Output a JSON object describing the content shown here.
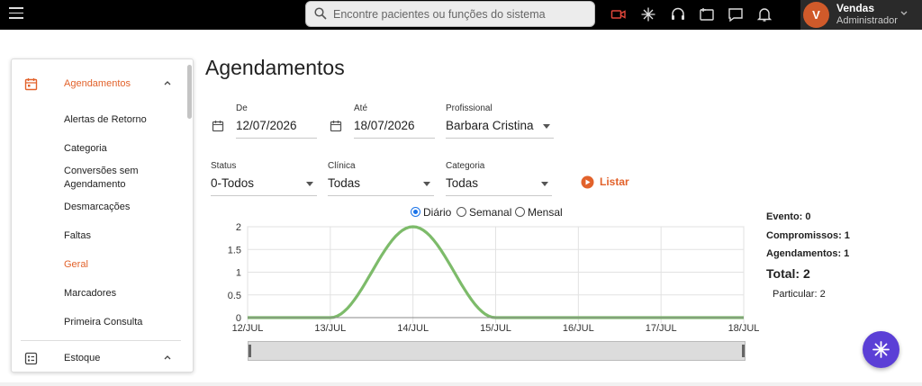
{
  "search": {
    "placeholder": "Encontre pacientes ou funções do sistema"
  },
  "user": {
    "initial": "V",
    "name": "Vendas",
    "role": "Administrador"
  },
  "sidebar": {
    "section_label": "Agendamentos",
    "items": [
      "Alertas de Retorno",
      "Categoria",
      "Conversões sem Agendamento",
      "Desmarcações",
      "Faltas",
      "Geral",
      "Marcadores",
      "Primeira Consulta"
    ],
    "active_item": "Geral",
    "second_section_label": "Estoque"
  },
  "page": {
    "title": "Agendamentos"
  },
  "filters": {
    "de_label": "De",
    "de_value": "12/07/2026",
    "ate_label": "Até",
    "ate_value": "18/07/2026",
    "profissional_label": "Profissional",
    "profissional_value": "Barbara Cristina",
    "status_label": "Status",
    "status_value": "0-Todos",
    "clinica_label": "Clínica",
    "clinica_value": "Todas",
    "categoria_label": "Categoria",
    "categoria_value": "Todas",
    "listar_label": "Listar"
  },
  "period": {
    "options": [
      "Diário",
      "Semanal",
      "Mensal"
    ],
    "selected": "Diário"
  },
  "stats": {
    "evento": "Evento: 0",
    "compromissos": "Compromissos: 1",
    "agendamentos": "Agendamentos: 1",
    "total": "Total: 2",
    "particular": "Particular: 2"
  },
  "colors": {
    "accent": "#e2622b",
    "line": "#7dbb6a",
    "fab": "#5b3fd6",
    "radio": "#1a73e8"
  },
  "chart_data": {
    "type": "line",
    "x": [
      "12/JUL",
      "13/JUL",
      "14/JUL",
      "15/JUL",
      "16/JUL",
      "17/JUL",
      "18/JUL"
    ],
    "values": [
      0,
      0,
      2,
      0,
      0,
      0,
      0
    ],
    "yticks": [
      "0",
      "0.5",
      "1",
      "1.5",
      "2"
    ],
    "ylim": [
      0,
      2
    ],
    "grid": true,
    "smooth": true
  }
}
